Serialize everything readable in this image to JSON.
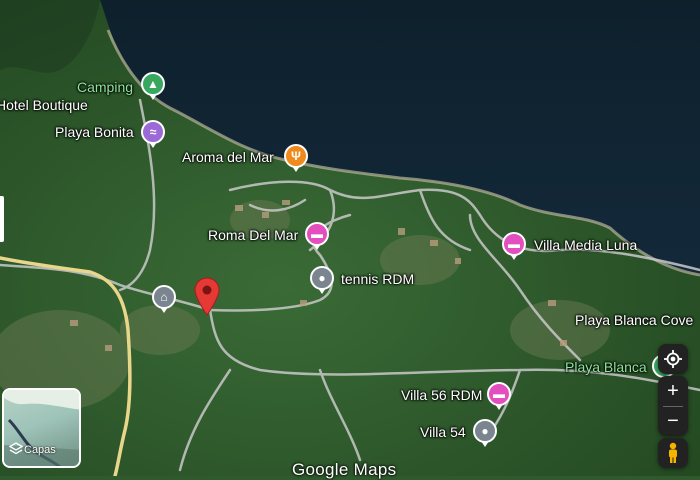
{
  "map": {
    "wordmark": "Google Maps",
    "layers_label": "Capas",
    "colors": {
      "water": "#0d1f2b",
      "forest": "#2e5a2d",
      "road_light": "#c9c9c9",
      "road_yellow": "#e8d68b",
      "lodging": "#e34fbe",
      "food": "#f08a1d",
      "park": "#38a860",
      "generic": "#7b8590",
      "education": "#7b8590",
      "dropped_pin": "#e53935"
    },
    "places": [
      {
        "name": "Camping",
        "type": "campground",
        "icon": "campground-icon",
        "color": "#38a860"
      },
      {
        "name": "Hotel Boutique",
        "type": "lodging-label",
        "icon": "",
        "color": ""
      },
      {
        "name": "Playa Bonita",
        "type": "beach",
        "icon": "beach-icon",
        "color": "#9c6ad6"
      },
      {
        "name": "Aroma del Mar",
        "type": "restaurant",
        "icon": "restaurant-icon",
        "color": "#f08a1d"
      },
      {
        "name": "Roma Del Mar",
        "type": "lodging",
        "icon": "bed-icon",
        "color": "#e34fbe"
      },
      {
        "name": "Villa Media Luna",
        "type": "lodging",
        "icon": "bed-icon",
        "color": "#e34fbe"
      },
      {
        "name": "tennis RDM",
        "type": "place",
        "icon": "place-icon",
        "color": "#7b8590"
      },
      {
        "name": "Playa Blanca Cove",
        "type": "label",
        "icon": "",
        "color": ""
      },
      {
        "name": "Playa Blanca",
        "type": "beach-label",
        "icon": "",
        "color": "#8fe39b"
      },
      {
        "name": "Villa 56 RDM",
        "type": "lodging",
        "icon": "bed-icon",
        "color": "#e34fbe"
      },
      {
        "name": "Villa 54",
        "type": "place",
        "icon": "place-icon",
        "color": "#7b8590"
      }
    ],
    "controls": {
      "locate": "my-location-icon",
      "zoom_in": "+",
      "zoom_out": "−",
      "street_view": "pegman-icon"
    }
  }
}
